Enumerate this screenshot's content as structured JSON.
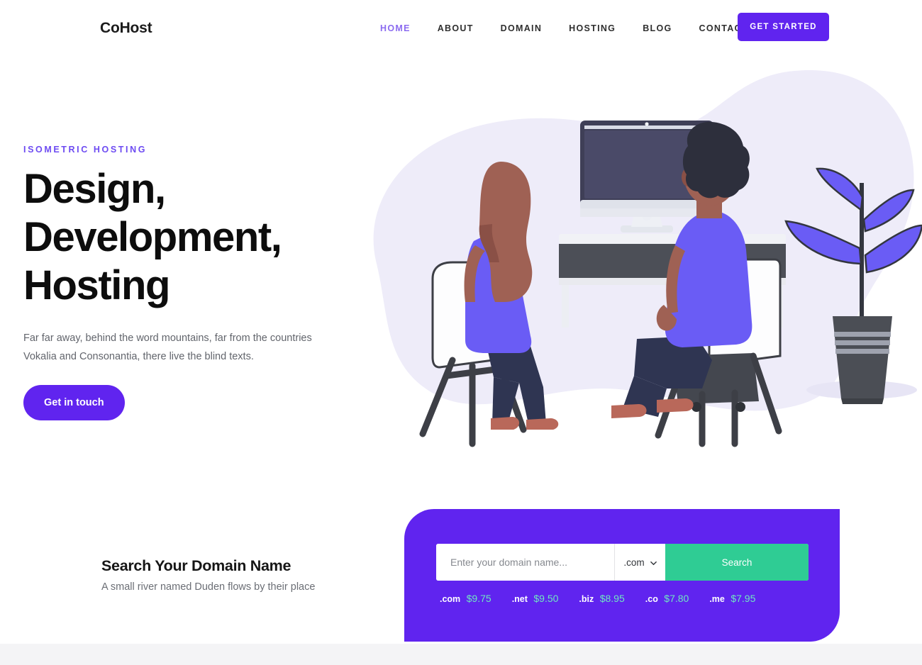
{
  "header": {
    "logo": "CoHost",
    "nav": [
      {
        "label": "HOME",
        "active": true
      },
      {
        "label": "ABOUT",
        "active": false
      },
      {
        "label": "DOMAIN",
        "active": false
      },
      {
        "label": "HOSTING",
        "active": false
      },
      {
        "label": "BLOG",
        "active": false
      },
      {
        "label": "CONTACT",
        "active": false
      }
    ],
    "cta_label": "GET STARTED"
  },
  "hero": {
    "eyebrow": "ISOMETRIC HOSTING",
    "title_line1": "Design,",
    "title_line2": "Development,",
    "title_line3": "Hosting",
    "description": "Far far away, behind the word mountains, far from the countries Vokalia and Consonantia, there live the blind texts.",
    "button_label": "Get in touch",
    "illustration_alt": "two people working at a desk with a desktop computer and a potted plant"
  },
  "domain": {
    "heading": "Search Your Domain Name",
    "subheading": "A small river named Duden flows by their place",
    "search_placeholder": "Enter your domain name...",
    "search_value": "",
    "tld_selected": ".com",
    "tld_options": [
      ".com",
      ".net",
      ".biz",
      ".co",
      ".me"
    ],
    "search_button_label": "Search",
    "prices": [
      {
        "tld": ".com",
        "price": "$9.75"
      },
      {
        "tld": ".net",
        "price": "$9.50"
      },
      {
        "tld": ".biz",
        "price": "$8.95"
      },
      {
        "tld": ".co",
        "price": "$7.80"
      },
      {
        "tld": ".me",
        "price": "$7.95"
      }
    ]
  },
  "colors": {
    "brand_purple": "#6024ef",
    "nav_active": "#8b6bf0",
    "eyebrow_purple": "#6d4bf2",
    "search_green": "#2fcc94",
    "price_green": "#6fe7c2",
    "blob_lavender": "#eeecf9",
    "body_text": "#62656c"
  }
}
